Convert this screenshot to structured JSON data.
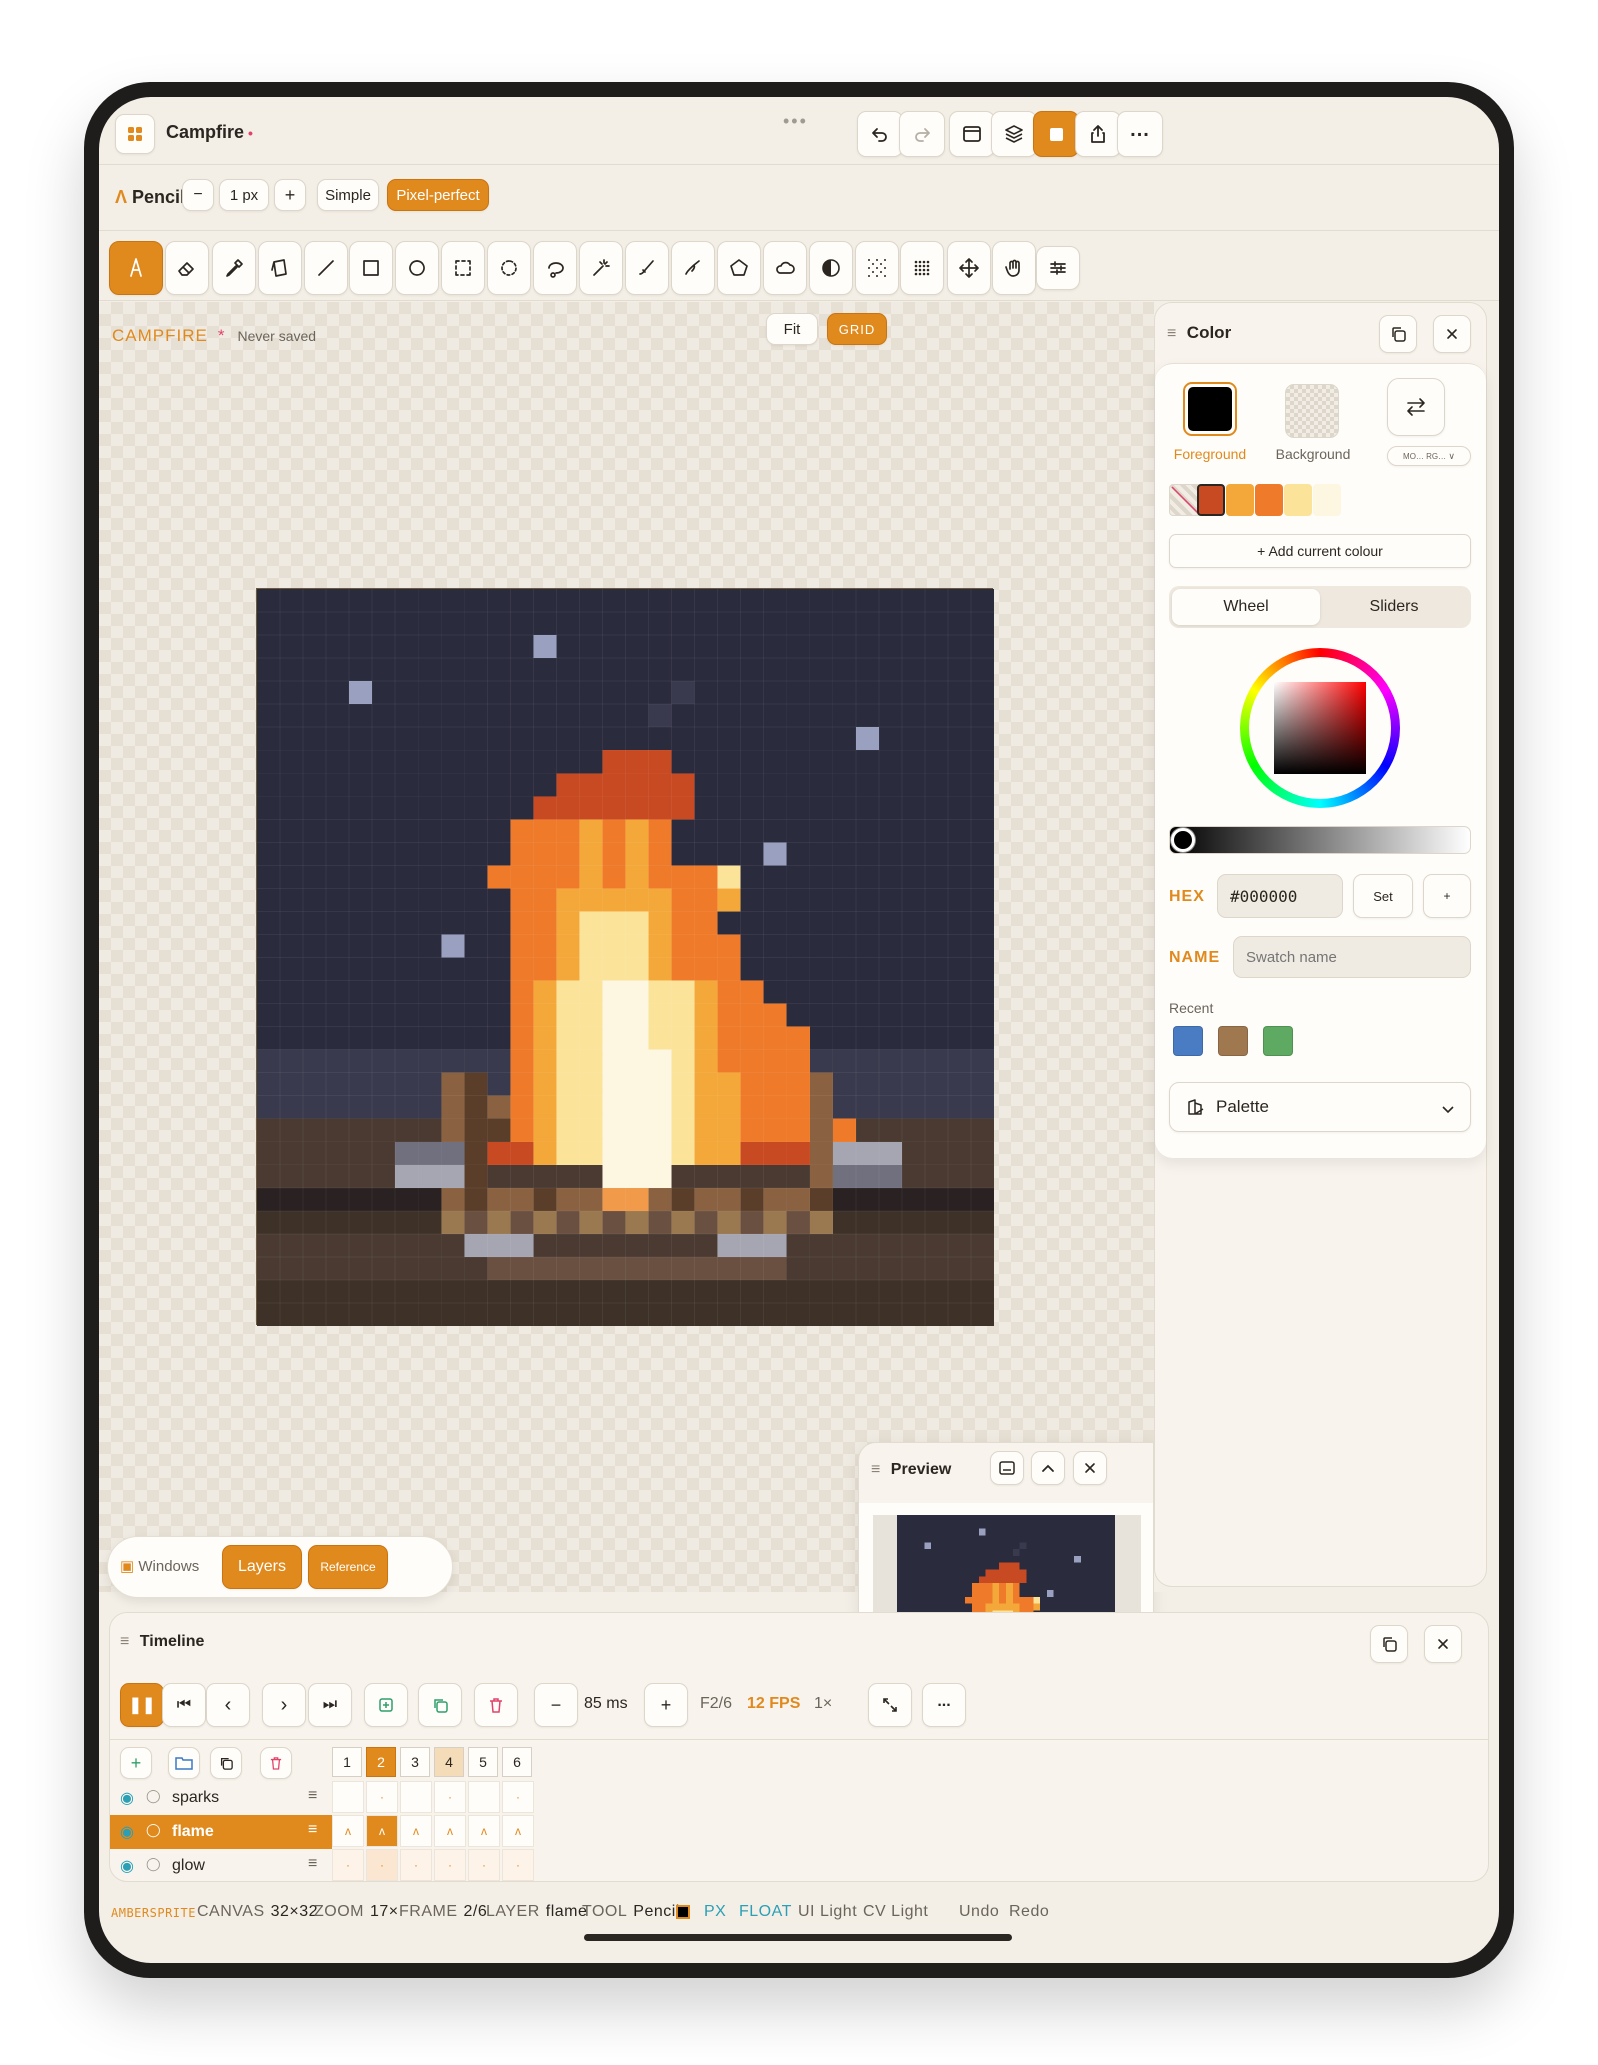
{
  "titlebar": {
    "title": "Campfire",
    "dirty": "•"
  },
  "tool_options": {
    "tool": "Pencil",
    "size": "1 px",
    "minus": "−",
    "plus": "+",
    "mode_simple": "Simple",
    "mode_pixel_perfect": "Pixel-perfect"
  },
  "tools": [
    "pencil",
    "eraser",
    "eyedropper",
    "bucket",
    "line",
    "rectangle",
    "ellipse",
    "rect-select",
    "ellipse-select",
    "lasso",
    "magic-wand",
    "brush",
    "smudge",
    "polygon",
    "cloud",
    "contrast",
    "dither",
    "pattern",
    "move",
    "hand",
    "settings"
  ],
  "canvas": {
    "doc_name": "CAMPFIRE",
    "star": "*",
    "save_status": "Never saved",
    "fit": "Fit",
    "grid": "GRID"
  },
  "windows_bar": {
    "label": "Windows",
    "layers": "Layers",
    "reference": "Reference"
  },
  "preview": {
    "title": "Preview"
  },
  "color_panel": {
    "title": "Color",
    "foreground_label": "Foreground",
    "background_label": "Background",
    "mode_label": "MO… RG…",
    "foreground_color": "#000000",
    "swatches": [
      "#c84a22",
      "#f4a83a",
      "#ee7a2a",
      "#fbe39a",
      "#fdf6e0"
    ],
    "add_current": "+ Add current colour",
    "tab_wheel": "Wheel",
    "tab_sliders": "Sliders",
    "hex_label": "HEX",
    "hex_value": "#000000",
    "set": "Set",
    "plus": "+",
    "name_label": "NAME",
    "name_placeholder": "Swatch name",
    "recent_label": "Recent",
    "recent": [
      "#4a7cc4",
      "#a07850",
      "#5eaa62"
    ],
    "palette": "Palette"
  },
  "timeline": {
    "title": "Timeline",
    "interval": "85 ms",
    "frame_pos": "F2/6",
    "fps": "12 FPS",
    "speed": "1×",
    "frames": [
      "1",
      "2",
      "3",
      "4",
      "5",
      "6"
    ],
    "layers": [
      {
        "name": "sparks"
      },
      {
        "name": "flame"
      },
      {
        "name": "glow"
      }
    ]
  },
  "statusbar": {
    "brand": "AMBERSPRITE",
    "canvas_label": "CANVAS",
    "canvas_value": "32×32",
    "zoom_label": "ZOOM",
    "zoom_value": "17×",
    "frame_label": "FRAME",
    "frame_value": "2/6",
    "layer_label": "LAYER",
    "layer_value": "flame",
    "tool_label": "TOOL",
    "tool_value": "Pencil",
    "px": "PX",
    "float": "FLOAT",
    "ui_light": "UI Light",
    "cv_light": "CV Light",
    "undo": "Undo",
    "redo": "Redo"
  }
}
